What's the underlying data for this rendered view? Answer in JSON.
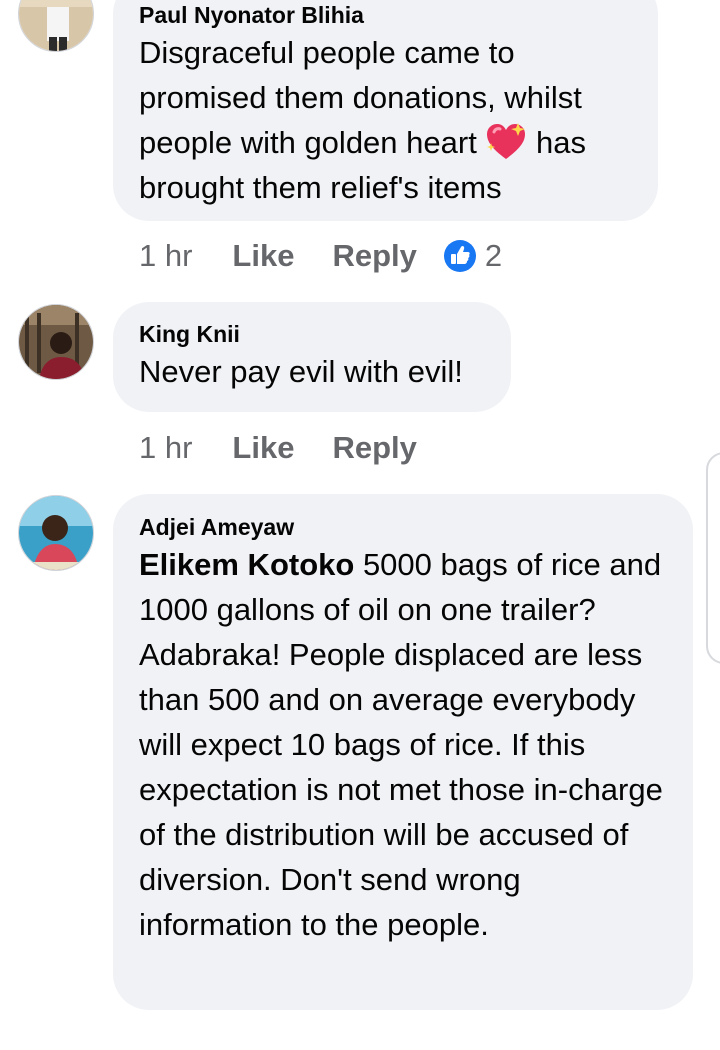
{
  "comments": [
    {
      "author": "Paul Nyonator Blihia",
      "text_before_emoji": "Disgraceful people came to promised them donations, whilst people with golden heart ",
      "emoji": "sparkling-heart",
      "text_after_emoji": " has brought them relief's items",
      "time": "1 hr",
      "like_label": "Like",
      "reply_label": "Reply",
      "reaction_count": "2",
      "reaction_icon": "like-reaction-icon"
    },
    {
      "author": "King Knii",
      "text": "Never pay evil with evil!",
      "time": "1 hr",
      "like_label": "Like",
      "reply_label": "Reply"
    },
    {
      "author": "Adjei Ameyaw",
      "mention": "Elikem Kotoko",
      "text": " 5000 bags of rice and 1000 gallons of oil on one trailer? Adabraka! People displaced are less than 500 and on average everybody will expect 10 bags of rice. If this expectation is not met those in-charge of the distribution will be accused of diversion. Don't send wrong information to the people."
    }
  ],
  "colors": {
    "bubble": "#f0f2f5",
    "meta_text": "#65676b",
    "like_blue": "#1877f2",
    "heart_pink": "#e8315b"
  }
}
